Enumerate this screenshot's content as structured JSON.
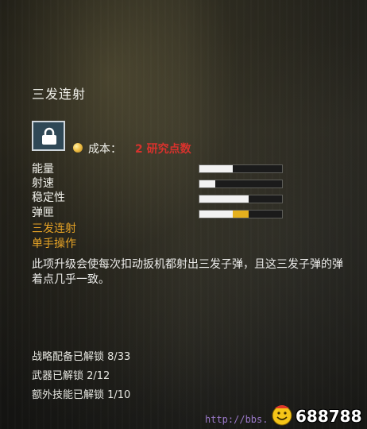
{
  "upgrade": {
    "title": "三发连射",
    "icon": "lock-icon",
    "cost_label": "成本：",
    "cost_value": "2 研究点数"
  },
  "stats": [
    {
      "label": "能量",
      "value": 0.4,
      "upgrade": 0
    },
    {
      "label": "射速",
      "value": 0.19,
      "upgrade": 0
    },
    {
      "label": "稳定性",
      "value": 0.6,
      "upgrade": 0
    },
    {
      "label": "弹匣",
      "value": 0.4,
      "upgrade": 0.2
    }
  ],
  "tags": [
    "三发连射",
    "单手操作"
  ],
  "description": "此项升级会使每次扣动扳机都射出三发子弹，且这三发子弹的弹着点几乎一致。",
  "unlocks": [
    "战略配备已解锁 8/33",
    "武器已解锁 2/12",
    "额外技能已解锁 1/10"
  ],
  "watermark": {
    "url": "http://bbs.",
    "number": "688788"
  },
  "colors": {
    "cost": "#d8322d",
    "tag": "#e6a326",
    "bar_fill": "#f2f2f2",
    "bar_upgrade": "#e5b01e"
  }
}
